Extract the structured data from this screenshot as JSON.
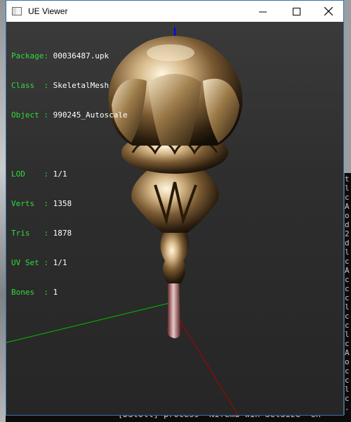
{
  "window": {
    "title": "UE Viewer",
    "buttons": {
      "minimize": "—",
      "maximize": "☐",
      "close": "✕"
    }
  },
  "info_top": [
    {
      "label": "Package:",
      "value": "00036487.upk"
    },
    {
      "label": "Class  :",
      "value": "SkeletalMesh"
    },
    {
      "label": "Object :",
      "value": "990245_Autoscale"
    }
  ],
  "info_mesh": [
    {
      "label": "LOD    :",
      "value": "1/1"
    },
    {
      "label": "Verts  :",
      "value": "1358"
    },
    {
      "label": "Tris   :",
      "value": "1878"
    },
    {
      "label": "UV Set :",
      "value": "1/1"
    },
    {
      "label": "Bones  :",
      "value": "1"
    }
  ],
  "console": {
    "side_glyphs": "t\nl\nc\nA\no\nd\n2\nd\nl\nc\nA\nc\nc\nc\nl\nc\nc\nl\nc\nA\no\nc\nc\nl\nc\n.",
    "bottom_line": "[DStoll] process  Nifemd win SetSize  en"
  },
  "colors": {
    "label": "#2fdc3a",
    "value": "#ffffff",
    "axis_x": "#00c000",
    "axis_y": "#b00000",
    "axis_z": "#0000ff"
  }
}
